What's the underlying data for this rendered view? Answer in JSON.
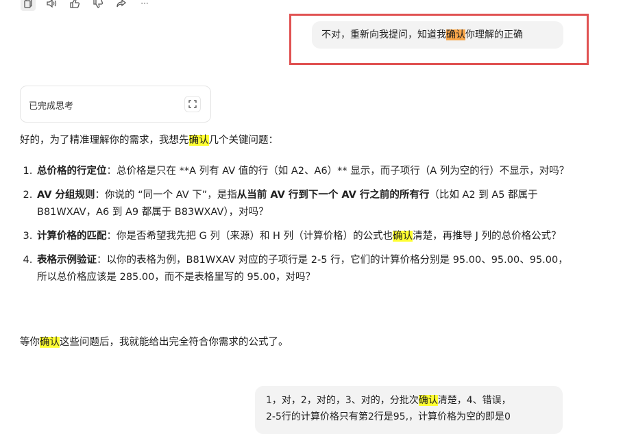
{
  "toolbar": {
    "icons": [
      "copy-icon",
      "speaker-icon",
      "thumbs-up-icon",
      "thumbs-down-icon",
      "share-icon",
      "more-icon"
    ],
    "more_label": "···"
  },
  "user_message": {
    "pre": "不对，重新向我提问，知道我",
    "highlight": "确认",
    "post": "你理解的正确"
  },
  "thinking": {
    "label": "已完成思考"
  },
  "assistant": {
    "intro_pre": "好的，为了精准理解你的需求，我想先",
    "intro_highlight": "确认",
    "intro_post": "几个关键问题：",
    "items": [
      {
        "bold": "总价格的行定位",
        "text": "：总价格是只在 **A 列有 AV 值的行（如 A2、A6）** 显示，而子项行（A 列为空的行）不显示，对吗？"
      },
      {
        "bold": "AV 分组规则",
        "text": "：你说的 “同一个 AV 下”，是指",
        "bold2": "从当前 AV 行到下一个 AV 行之前的所有行",
        "text2": "（比如 A2 到 A5 都属于 B81WXAV，A6 到 A9 都属于 B83WXAV），对吗？"
      },
      {
        "bold": "计算价格的匹配",
        "text": "：你是否希望我先把 G 列（来源）和 H 列（计算价格）的公式也",
        "highlight": "确认",
        "text2": "清楚，再推导 J 列的总价格公式？"
      },
      {
        "bold": "表格示例验证",
        "text": "：以你的表格为例，B81WXAV 对应的子项行是 2-5 行，它们的计算价格分别是 95.00、95.00、95.00，所以总价格应该是 285.00，而不是表格里写的 95.00，对吗？"
      }
    ],
    "outro_pre": "等你",
    "outro_highlight": "确认",
    "outro_post": "这些问题后，我就能给出完全符合你需求的公式了。"
  },
  "user_reply": {
    "line1_pre": "1，对，2，对的，3、对的，分批次",
    "line1_highlight": "确认",
    "line1_post": "清楚，4、错误，",
    "line2": "2-5行的计算价格只有第2行是95,，计算价格为空的即是0"
  },
  "colors": {
    "highlight_orange": "#f7a54a",
    "highlight_yellow": "#ffff33",
    "annotation_red": "#e05252",
    "bubble_bg": "#f3f3f3"
  }
}
